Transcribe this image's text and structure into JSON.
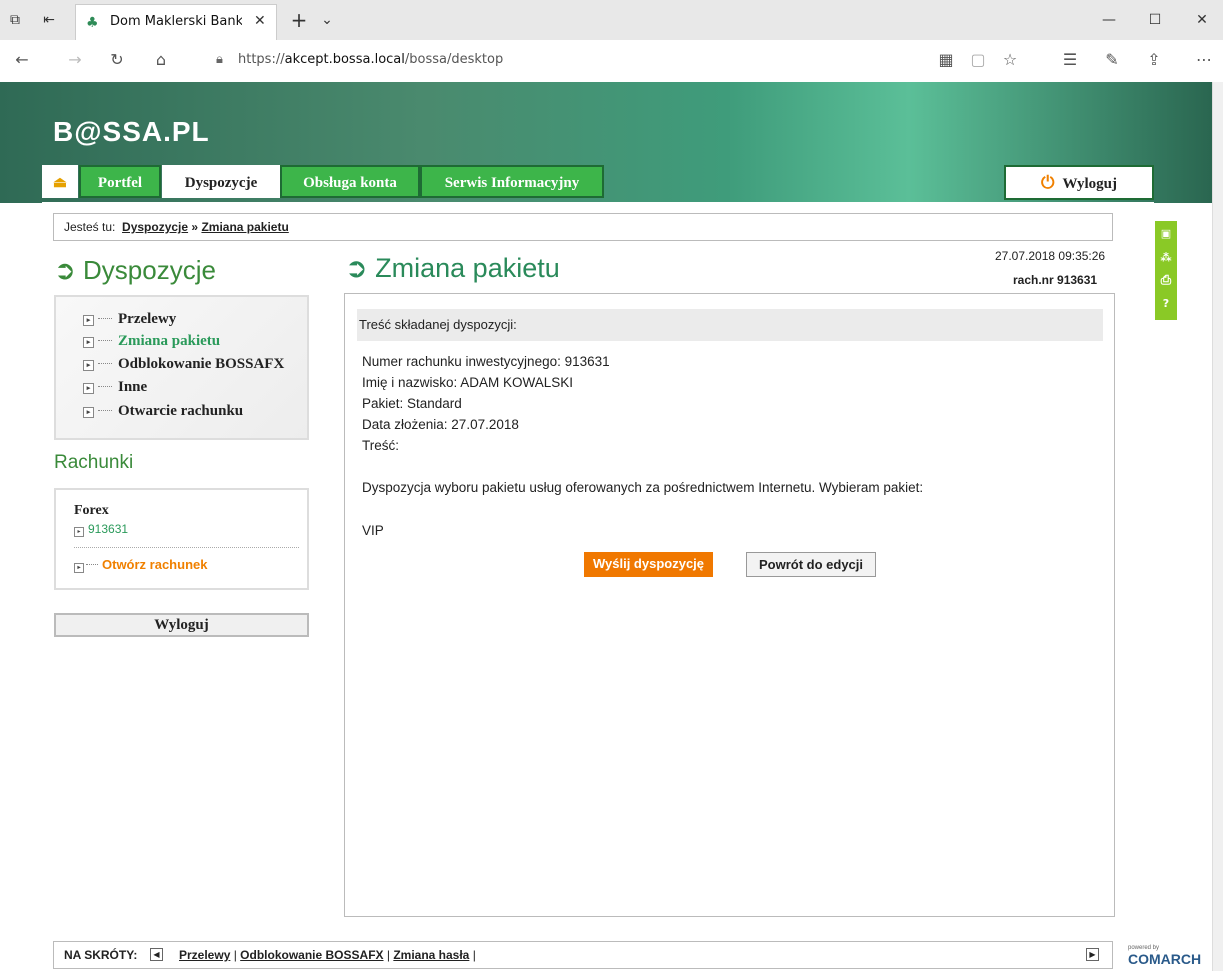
{
  "browser": {
    "tab_title": "Dom Maklerski Banku C",
    "url_prefix": "https://",
    "url_host": "akcept.bossa.local",
    "url_path": "/bossa/desktop"
  },
  "site": {
    "logo": "B@SSA.PL",
    "nav": {
      "portfel": "Portfel",
      "dyspozycje": "Dyspozycje",
      "obsluga": "Obsługa konta",
      "serwis": "Serwis Informacyjny",
      "logout": "Wyloguj"
    }
  },
  "breadcrumb": {
    "prefix": "Jesteś tu:",
    "item1": "Dyspozycje",
    "sep": "»",
    "item2": "Zmiana pakietu"
  },
  "sidebar": {
    "title": "Dyspozycje",
    "items": [
      "Przelewy",
      "Zmiana pakietu",
      "Odblokowanie BOSSAFX",
      "Inne",
      "Otwarcie rachunku"
    ],
    "accounts_title": "Rachunki",
    "account_type": "Forex",
    "account_number": "913631",
    "open_account": "Otwórz rachunek",
    "logout": "Wyloguj"
  },
  "main": {
    "title": "Zmiana pakietu",
    "datetime": "27.07.2018 09:35:26",
    "account_label": "rach.nr 913631",
    "panel_header": "Treść składanej dyspozycji:",
    "lines": [
      "Numer rachunku inwestycyjnego: 913631",
      "Imię i nazwisko: ADAM KOWALSKI",
      "Pakiet: Standard",
      "Data złożenia: 27.07.2018",
      "Treść:"
    ],
    "body_text": "Dyspozycja wyboru pakietu usług oferowanych za pośrednictwem Internetu. Wybieram pakiet:",
    "package": "VIP",
    "send_button": "Wyślij dyspozycję",
    "back_button": "Powrót do edycji"
  },
  "shortcuts": {
    "label": "NA SKRÓTY:",
    "items": [
      "Przelewy",
      "Odblokowanie BOSSAFX",
      "Zmiana hasła"
    ]
  },
  "footer": {
    "powered": "powered by",
    "brand": "COMARCH"
  },
  "colors": {
    "green_tab": "#3db54a",
    "accent_orange": "#f07800",
    "title_green": "#2a8a5a"
  }
}
